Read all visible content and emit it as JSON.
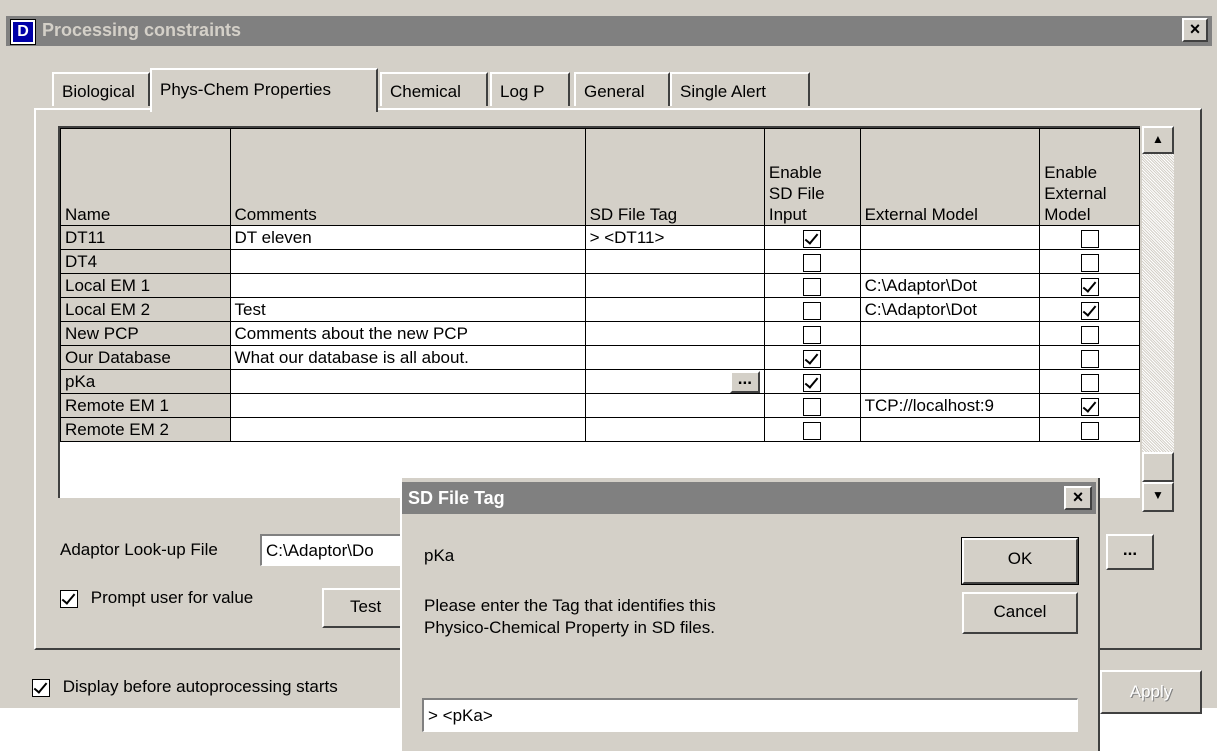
{
  "window": {
    "title": "Processing constraints",
    "icon_letter": "D",
    "close_label": "×"
  },
  "tabs": [
    {
      "label": "Biological"
    },
    {
      "label": "Phys-Chem Properties",
      "active": true
    },
    {
      "label": "Chemical"
    },
    {
      "label": "Log P"
    },
    {
      "label": "General"
    },
    {
      "label": "Single Alert"
    }
  ],
  "grid": {
    "headers": {
      "name": "Name",
      "comments": "Comments",
      "sd_tag": "SD File Tag",
      "enable_sd": "Enable\nSD File\nInput",
      "external_model": "External Model",
      "enable_external": "Enable\nExternal\nModel"
    },
    "rows": [
      {
        "name": "DT11",
        "comments": "DT eleven",
        "sd_tag": "> <DT11>",
        "enable_sd": true,
        "external_model": "",
        "enable_external": false
      },
      {
        "name": "DT4",
        "comments": "",
        "sd_tag": "",
        "enable_sd": false,
        "external_model": "",
        "enable_external": false
      },
      {
        "name": "Local EM 1",
        "comments": "",
        "sd_tag": "",
        "enable_sd": false,
        "external_model": "C:\\Adaptor\\Dot",
        "enable_external": true
      },
      {
        "name": "Local EM 2",
        "comments": "Test",
        "sd_tag": "",
        "enable_sd": false,
        "external_model": "C:\\Adaptor\\Dot",
        "enable_external": true
      },
      {
        "name": "New PCP",
        "comments": "Comments about the new PCP",
        "sd_tag": "",
        "enable_sd": false,
        "external_model": "",
        "enable_external": false
      },
      {
        "name": "Our Database",
        "comments": "What our database is all about.",
        "sd_tag": "",
        "enable_sd": true,
        "external_model": "",
        "enable_external": false
      },
      {
        "name": "pKa",
        "comments": "",
        "sd_tag": "",
        "enable_sd": true,
        "external_model": "",
        "enable_external": false,
        "browse": "..."
      },
      {
        "name": "Remote EM 1",
        "comments": "",
        "sd_tag": "",
        "enable_sd": false,
        "external_model": "TCP://localhost:9",
        "enable_external": true
      },
      {
        "name": "Remote EM 2",
        "comments": "",
        "sd_tag": "",
        "enable_sd": false,
        "external_model": "",
        "enable_external": false
      }
    ]
  },
  "scroll": {
    "up": "▲",
    "down": "▼"
  },
  "lookup": {
    "label": "Adaptor Look-up File",
    "value": "C:\\Adaptor\\Do",
    "browse": "..."
  },
  "prompt": {
    "label": "Prompt user for value",
    "checked": true
  },
  "test_button": "Test",
  "display_before": {
    "label": "Display before autoprocessing starts",
    "checked": true
  },
  "apply_button": "Apply",
  "dialog": {
    "title": "SD File Tag",
    "close_label": "×",
    "property": "pKa",
    "message_line1": "Please enter the Tag that identifies this",
    "message_line2": "Physico-Chemical Property in SD files.",
    "ok": "OK",
    "cancel": "Cancel",
    "input_value": "> <pKa>"
  }
}
